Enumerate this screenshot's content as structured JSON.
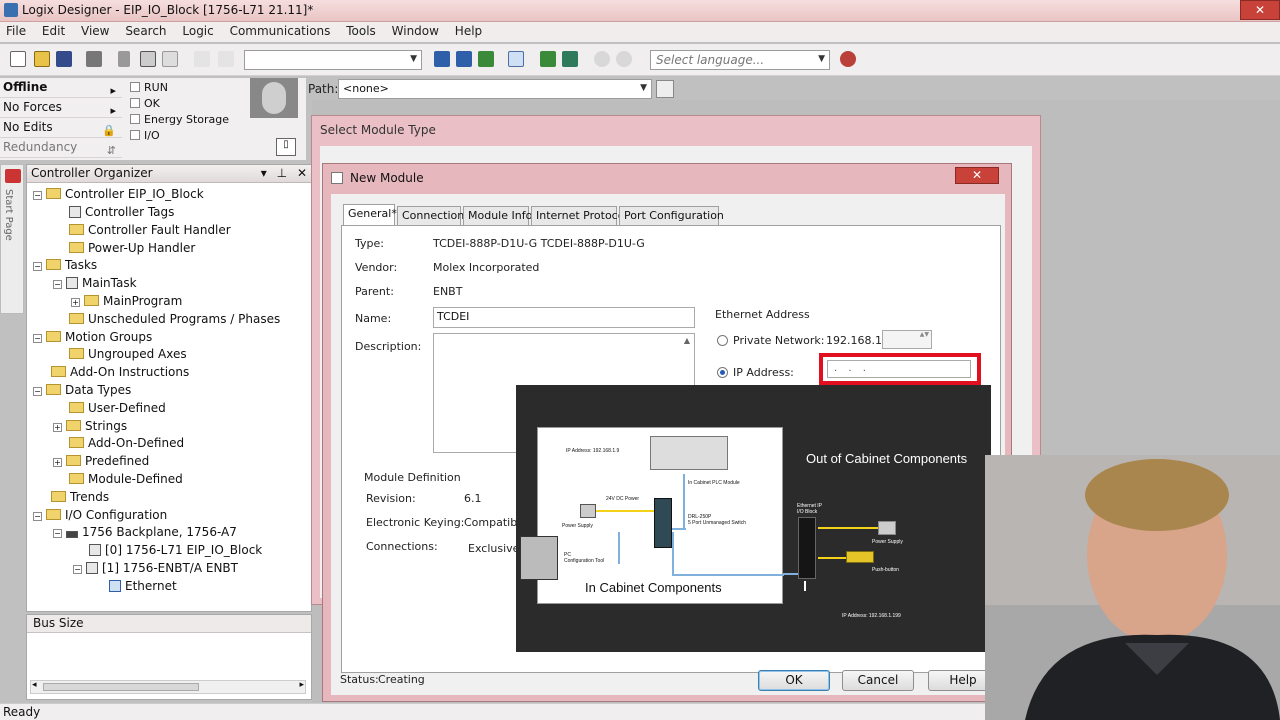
{
  "window": {
    "title": "Logix Designer - EIP_IO_Block [1756-L71 21.11]*"
  },
  "menu": [
    "File",
    "Edit",
    "View",
    "Search",
    "Logic",
    "Communications",
    "Tools",
    "Window",
    "Help"
  ],
  "toolbar": {
    "language_placeholder": "Select language..."
  },
  "status": {
    "mode": "Offline",
    "forces": "No Forces",
    "edits": "No Edits",
    "redundancy": "Redundancy",
    "indicators": [
      "RUN",
      "OK",
      "Energy Storage",
      "I/O"
    ]
  },
  "path": {
    "label": "Path:",
    "value": "<none>"
  },
  "organizer": {
    "title": "Controller Organizer",
    "start_page": "Start Page",
    "items": [
      "Controller EIP_IO_Block",
      "Controller Tags",
      "Controller Fault Handler",
      "Power-Up Handler",
      "Tasks",
      "MainTask",
      "MainProgram",
      "Unscheduled Programs / Phases",
      "Motion Groups",
      "Ungrouped Axes",
      "Add-On Instructions",
      "Data Types",
      "User-Defined",
      "Strings",
      "Add-On-Defined",
      "Predefined",
      "Module-Defined",
      "Trends",
      "I/O Configuration",
      "1756 Backplane, 1756-A7",
      "[0] 1756-L71 EIP_IO_Block",
      "[1] 1756-ENBT/A ENBT",
      "Ethernet"
    ]
  },
  "bus_size": {
    "label": "Bus Size"
  },
  "statusbar": {
    "text": "Ready"
  },
  "select_module": {
    "title": "Select Module Type"
  },
  "new_module": {
    "title": "New Module",
    "tabs": [
      "General*",
      "Connection",
      "Module Info",
      "Internet Protocol",
      "Port Configuration"
    ],
    "type_label": "Type:",
    "type_value": "TCDEI-888P-D1U-G TCDEI-888P-D1U-G",
    "vendor_label": "Vendor:",
    "vendor_value": "Molex Incorporated",
    "parent_label": "Parent:",
    "parent_value": "ENBT",
    "name_label": "Name:",
    "name_value": "TCDEI",
    "description_label": "Description:",
    "ethernet_address": "Ethernet Address",
    "private_network_label": "Private Network:",
    "private_network_value": "192.168.1.",
    "ip_address_label": "IP Address:",
    "module_definition": "Module Definition",
    "revision_label": "Revision:",
    "revision_value": "6.1",
    "keying_label": "Electronic Keying:",
    "keying_value": "Compatible",
    "connections_label": "Connections:",
    "connections_value": "Exclusive",
    "status_label": "Status:",
    "status_value": "Creating",
    "ok": "OK",
    "cancel": "Cancel",
    "help": "Help"
  },
  "overlay": {
    "out_title": "Out of Cabinet Components",
    "in_title": "In Cabinet Components",
    "labels": {
      "ip_plc": "IP Address: 192.168.1.9",
      "plc": "In Cabinet PLC Module",
      "power24": "24V DC Power",
      "power_supply": "Power Supply",
      "drl": "DRL-250P",
      "switch": "5 Port Unmanaged Switch",
      "pc": "PC",
      "pc_tool": "Configuration Tool",
      "eip_block_1": "Ethernet IP",
      "eip_block_2": "I/O Block",
      "out_power": "Power Supply",
      "pushbutton": "Push-button",
      "ip_block": "IP Address: 192.168.1.199"
    }
  }
}
